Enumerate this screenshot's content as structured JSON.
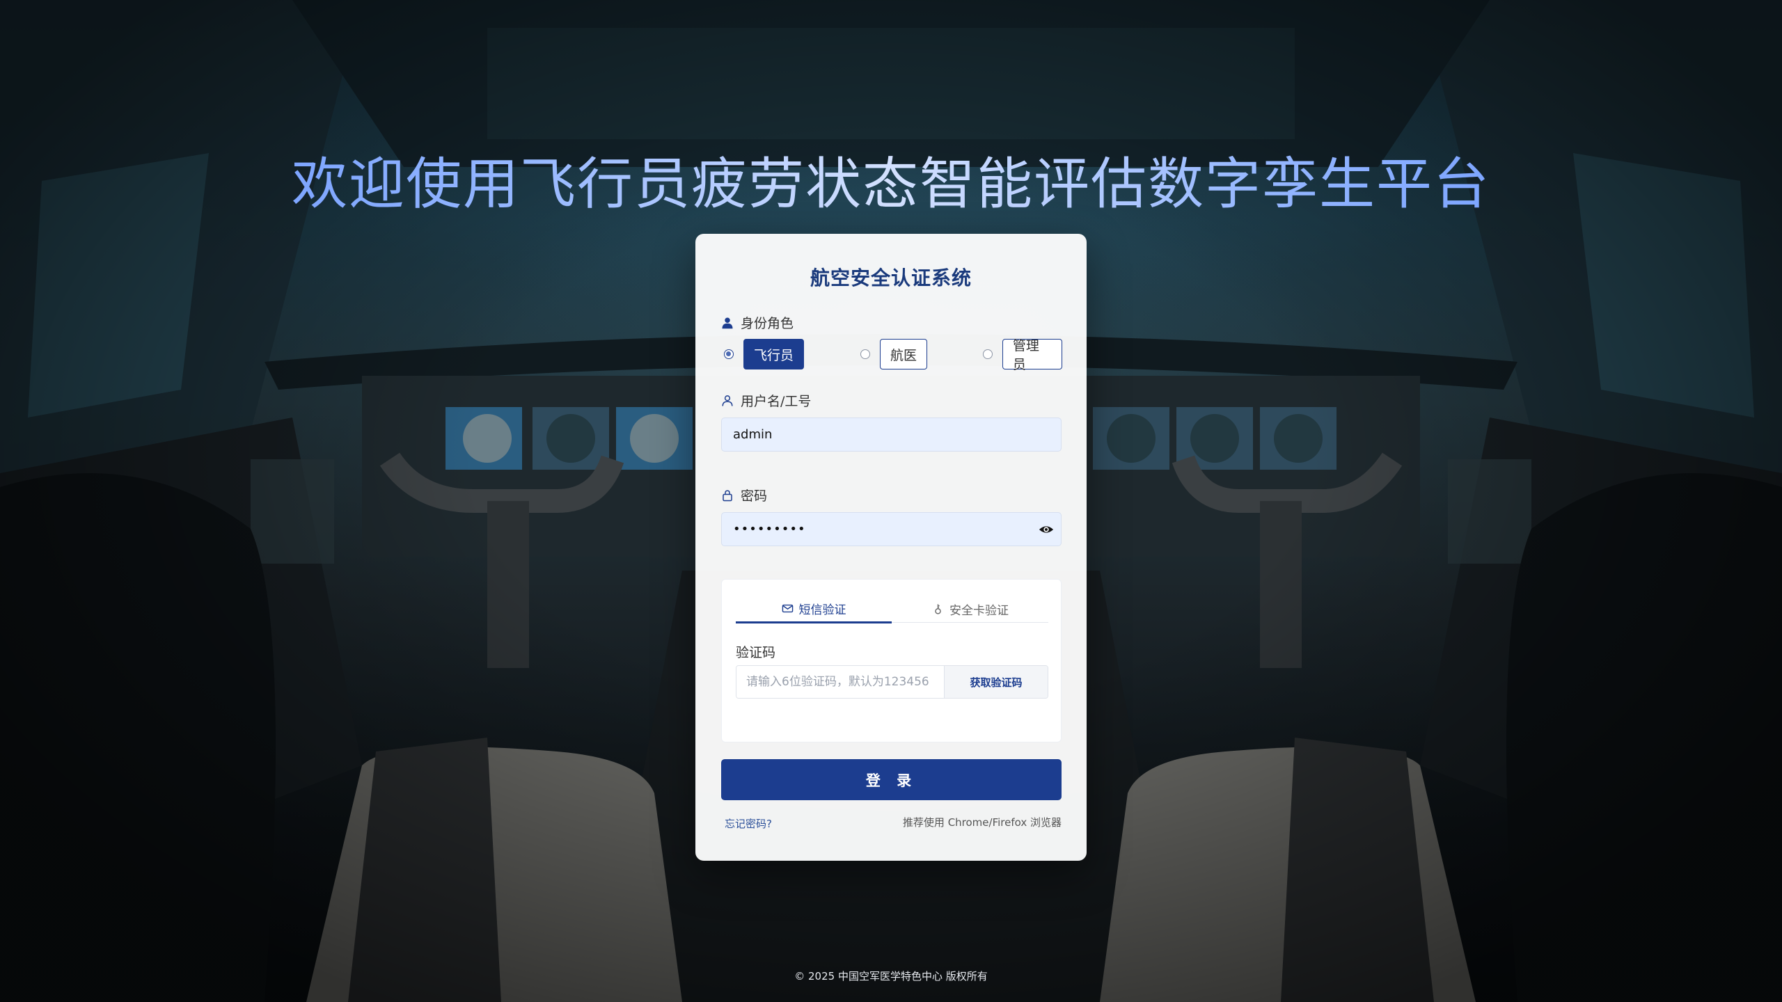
{
  "headline": "欢迎使用飞行员疲劳状态智能评估数字孪生平台",
  "card": {
    "title": "航空安全认证系统",
    "role_label": "身份角色",
    "roles": [
      {
        "label": "飞行员",
        "selected": true
      },
      {
        "label": "航医",
        "selected": false
      },
      {
        "label": "管理员",
        "selected": false
      }
    ],
    "username_label": "用户名/工号",
    "username_value": "admin",
    "password_label": "密码",
    "password_masked": "•••••••••",
    "verify": {
      "tabs": [
        {
          "label": "短信验证",
          "active": true,
          "icon": "mail-icon"
        },
        {
          "label": "安全卡验证",
          "active": false,
          "icon": "key-icon"
        }
      ],
      "code_label": "验证码",
      "code_placeholder": "请输入6位验证码，默认为123456",
      "get_code_label": "获取验证码"
    },
    "login_label": "登 录",
    "forgot_label": "忘记密码?",
    "browser_tip": "推荐使用 Chrome/Firefox 浏览器"
  },
  "footer": {
    "copyright": "© 2025 中国空军医学特色中心 版权所有"
  },
  "colors": {
    "primary": "#1c3d8f",
    "input_bg": "#e8f0fe",
    "headline_gradient_start": "#5b8cff"
  }
}
